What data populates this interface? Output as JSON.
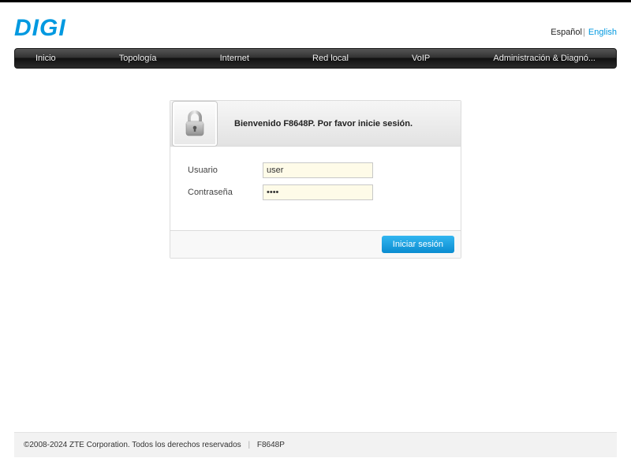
{
  "brand": "DIGI",
  "language": {
    "es": "Español",
    "en": "English"
  },
  "nav": {
    "items": [
      {
        "label": "Inicio"
      },
      {
        "label": "Topología"
      },
      {
        "label": "Internet"
      },
      {
        "label": "Red local"
      },
      {
        "label": "VoIP"
      },
      {
        "label": "Administración & Diagnó..."
      }
    ]
  },
  "login": {
    "welcome": "Bienvenido F8648P. Por favor inicie sesión.",
    "username_label": "Usuario",
    "password_label": "Contraseña",
    "username_value": "user",
    "password_value": "••••",
    "submit": "Iniciar sesión"
  },
  "footer": {
    "copyright": "©2008-2024 ZTE Corporation. Todos los derechos reservados",
    "model": "F8648P"
  }
}
